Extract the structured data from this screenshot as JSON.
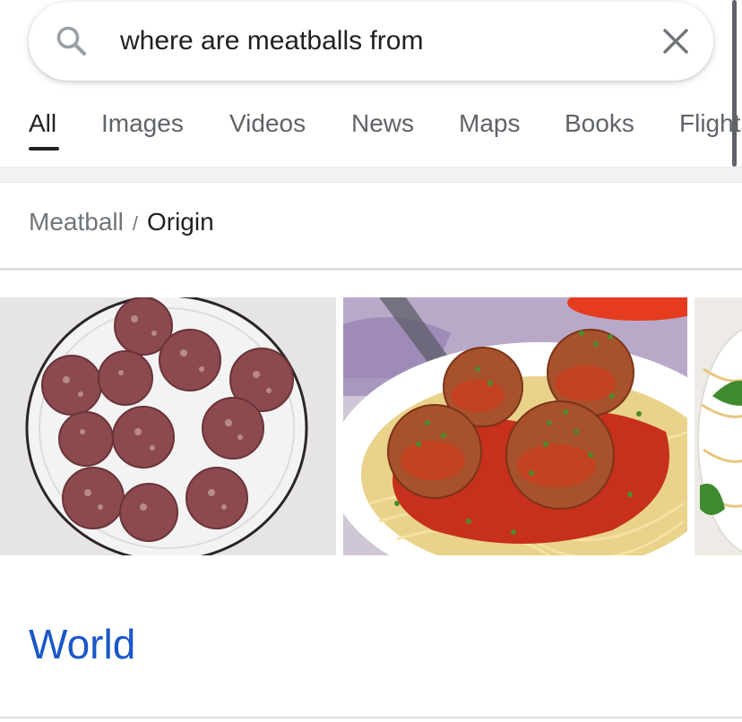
{
  "search": {
    "query": "where are meatballs from",
    "search_icon": "search-icon",
    "clear_icon": "close-icon"
  },
  "tabs": [
    {
      "label": "All",
      "active": true
    },
    {
      "label": "Images",
      "active": false
    },
    {
      "label": "Videos",
      "active": false
    },
    {
      "label": "News",
      "active": false
    },
    {
      "label": "Maps",
      "active": false
    },
    {
      "label": "Books",
      "active": false
    },
    {
      "label": "Flights",
      "active": false
    }
  ],
  "breadcrumb": {
    "parent": "Meatball",
    "separator": "/",
    "current": "Origin"
  },
  "images": [
    {
      "name": "raw-meatballs-on-plate-image"
    },
    {
      "name": "spaghetti-meatballs-image"
    },
    {
      "name": "spaghetti-partial-image"
    }
  ],
  "answer": {
    "text": "World"
  },
  "colors": {
    "accent_link": "#1a57c9",
    "tab_active": "#202124",
    "tab_inactive": "#5f6368"
  }
}
